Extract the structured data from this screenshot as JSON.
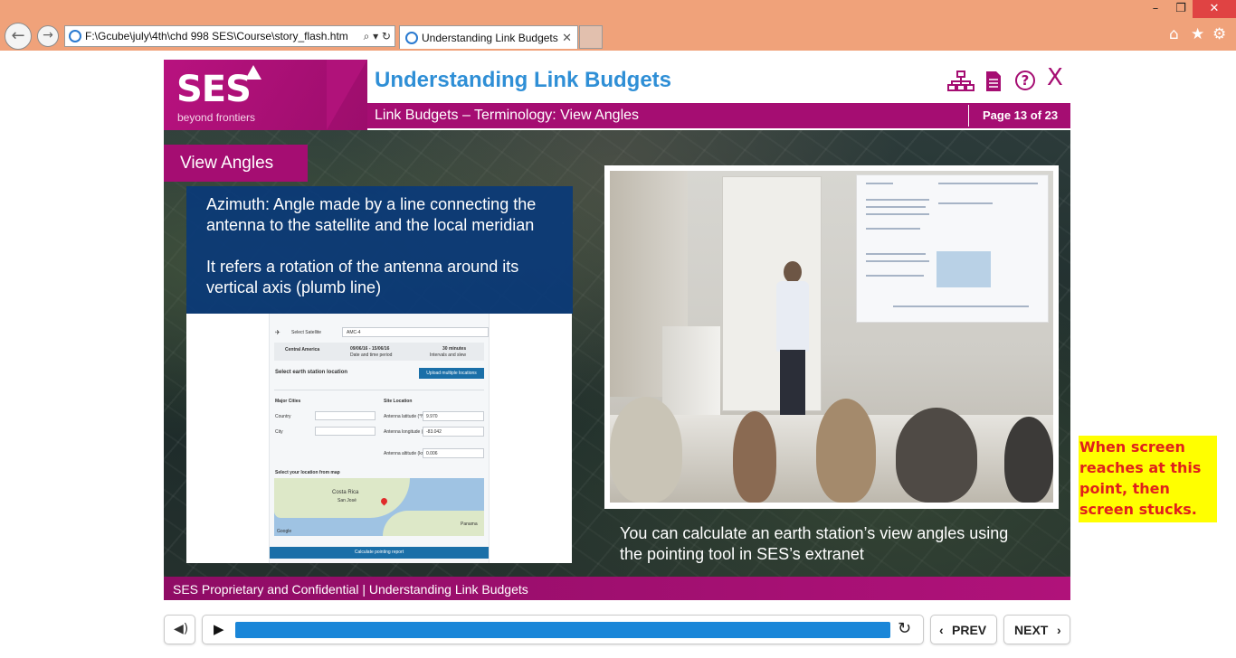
{
  "browser": {
    "address": "F:\\Gcube\\july\\4th\\chd 998 SES\\Course\\story_flash.htm",
    "tab_title": "Understanding Link Budgets"
  },
  "course": {
    "logo": "SES",
    "tagline": "beyond frontiers",
    "title": "Understanding Link Budgets",
    "subtitle": "Link Budgets – Terminology: View Angles",
    "page_indicator": "Page 13 of 23",
    "section_label": "View Angles",
    "text_paragraphs": [
      "Azimuth: Angle made by a line connecting the antenna to the satellite and the local meridian",
      "It refers a rotation of the antenna around its vertical axis (plumb line)"
    ],
    "caption": "You can calculate an earth station’s view angles using the pointing tool in SES’s extranet",
    "footer": "SES Proprietary and Confidential | Understanding Link Budgets",
    "pointing_tool": {
      "select_satellite": "Select Satellite",
      "satellite_value": "AMC-4",
      "region": "Central America",
      "date_range": "09/06/16 - 15/06/16",
      "date_sub": "Date and time period",
      "interval": "30 minutes",
      "interval_sub": "Intervals and slew",
      "section_title": "Select earth station location",
      "upload_button": "Upload multiple locations",
      "major_cities": "Major Cities",
      "site_location": "Site Location",
      "country_label": "Country",
      "city_label": "City",
      "lat_label": "Antenna latitude (°N)",
      "lat_value": "9.970",
      "lon_label": "Antenna longitude (°E)",
      "lon_value": "-83.042",
      "alt_label": "Antenna altitude (km)",
      "alt_value": "0.006",
      "map_label": "Select your location from map",
      "map_place": "Costa Rica",
      "map_city": "San José",
      "map_google": "Google",
      "map_panama": "Panama",
      "calc_button": "Calculate pointing report"
    }
  },
  "annotation_note": "When screen reaches at this point, then screen stucks.",
  "player": {
    "prev_label": "PREV",
    "next_label": "NEXT",
    "progress_fraction": 1.0
  },
  "icons": {
    "back": "back-arrow-icon",
    "forward": "forward-arrow-icon",
    "home": "home-icon",
    "favorites": "star-icon",
    "settings": "gear-icon",
    "sitemap": "sitemap-icon",
    "document": "document-icon",
    "help": "help-icon",
    "close": "close-icon",
    "volume": "volume-icon",
    "play": "play-icon",
    "replay": "replay-icon"
  },
  "colors": {
    "brand_magenta": "#a50d72",
    "title_blue": "#2f8fd6",
    "text_box_navy": "#0a3a78",
    "progress_blue": "#1a86d8",
    "note_yellow": "#ffff00",
    "note_red": "#e0201c",
    "chrome_orange": "#f0a27a"
  }
}
